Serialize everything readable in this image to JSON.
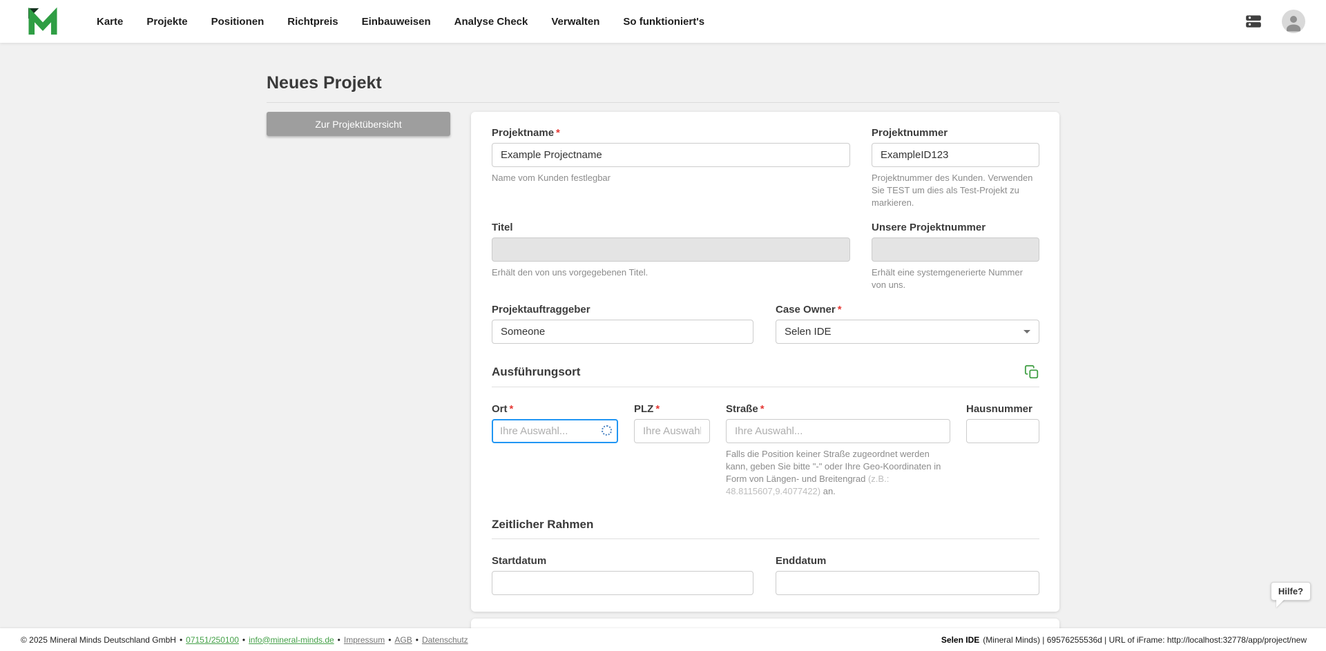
{
  "nav": {
    "items": [
      "Karte",
      "Projekte",
      "Positionen",
      "Richtpreis",
      "Einbauweisen",
      "Analyse Check",
      "Verwalten",
      "So funktioniert's"
    ]
  },
  "page": {
    "title": "Neues Projekt",
    "back_button": "Zur Projektübersicht"
  },
  "form": {
    "required_marker": "*",
    "projektname": {
      "label": "Projektname",
      "value": "Example Projectname",
      "hint": "Name vom Kunden festlegbar"
    },
    "projektnummer": {
      "label": "Projektnummer",
      "value": "ExampleID123",
      "hint": "Projektnummer des Kunden. Verwenden Sie TEST um dies als Test-Projekt zu markieren."
    },
    "titel": {
      "label": "Titel",
      "value": "",
      "hint": "Erhält den von uns vorgegebenen Titel."
    },
    "unsere_projektnummer": {
      "label": "Unsere Projektnummer",
      "value": "",
      "hint": "Erhält eine systemgenerierte Nummer von uns."
    },
    "projektauftraggeber": {
      "label": "Projektauftraggeber",
      "value": "Someone"
    },
    "case_owner": {
      "label": "Case Owner",
      "value": "Selen IDE"
    },
    "section_ausfuehrungsort": "Ausführungsort",
    "section_zeitlicher_rahmen": "Zeitlicher Rahmen",
    "ort": {
      "label": "Ort",
      "placeholder": "Ihre Auswahl..."
    },
    "plz": {
      "label": "PLZ",
      "placeholder": "Ihre Auswahl."
    },
    "strasse": {
      "label": "Straße",
      "placeholder": "Ihre Auswahl...",
      "hint_main": "Falls die Position keiner Straße zugeordnet werden kann, geben Sie bitte \"-\" oder Ihre Geo-Koordinaten in Form von Längen- und Breitengrad ",
      "hint_example": "(z.B.: 48.8115607,9.4077422)",
      "hint_suffix": " an."
    },
    "hausnummer": {
      "label": "Hausnummer"
    },
    "startdatum": {
      "label": "Startdatum"
    },
    "enddatum": {
      "label": "Enddatum"
    }
  },
  "help": {
    "label": "Hilfe?"
  },
  "footer": {
    "copyright": "© 2025 Mineral Minds Deutschland GmbH",
    "separator": "•",
    "phone": "07151/250100",
    "email": "info@mineral-minds.de",
    "links": [
      "Impressum",
      "AGB",
      "Datenschutz"
    ],
    "right_bold": "Selen IDE",
    "right_rest": " (Mineral Minds) | 69576255536d | URL of iFrame: http://localhost:32778/app/project/new"
  },
  "icons": {
    "logo": "mineral-minds-logo",
    "server": "server-icon",
    "avatar": "user-avatar-icon",
    "copy": "copy-icon",
    "chevron": "chevron-down-icon",
    "spinner": "loading-spinner-icon"
  },
  "colors": {
    "accent_green": "#43a047",
    "focus_blue": "#2196f3",
    "required_red": "#e53935",
    "button_gray": "#9e9e9e"
  }
}
